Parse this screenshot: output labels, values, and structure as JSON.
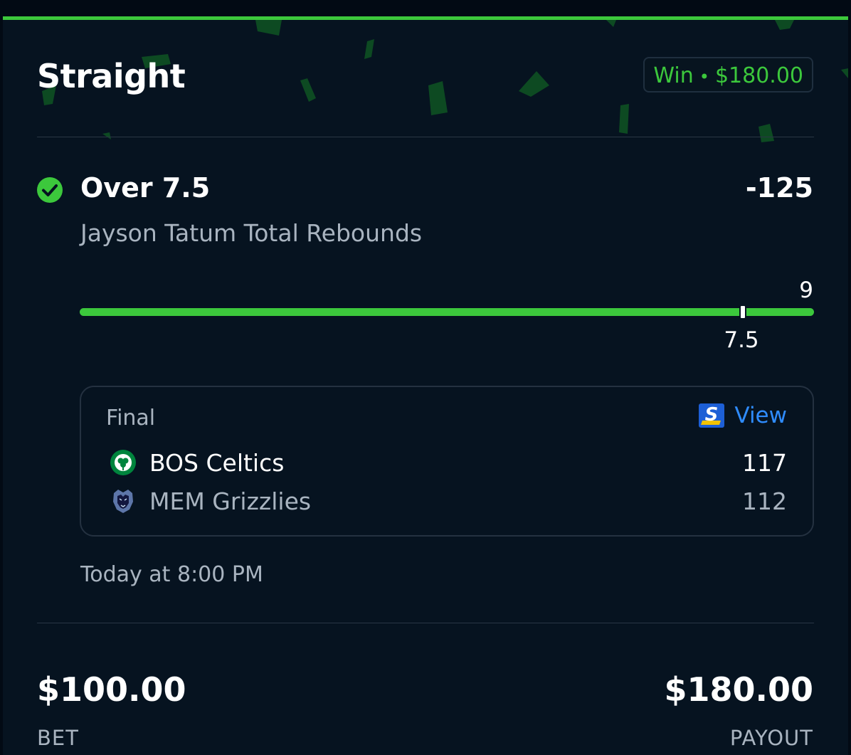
{
  "bet": {
    "type_label": "Straight",
    "result_label": "Win",
    "result_separator": "•",
    "result_amount": "$180.00",
    "selection": "Over 7.5",
    "odds": "-125",
    "market": "Jayson Tatum Total Rebounds"
  },
  "progress": {
    "current_value": "9",
    "line_value": "7.5",
    "current": 9,
    "line": 7.5,
    "fill_fraction": 1.0,
    "line_fraction": 0.901
  },
  "game": {
    "status": "Final",
    "view_label": "View",
    "teams": [
      {
        "name": "BOS Celtics",
        "score": "117",
        "logo": "celtics-logo"
      },
      {
        "name": "MEM Grizzlies",
        "score": "112",
        "logo": "grizzlies-logo"
      }
    ],
    "time": "Today at 8:00 PM"
  },
  "summary": {
    "bet_amount": "$100.00",
    "bet_label": "BET",
    "payout_amount": "$180.00",
    "payout_label": "PAYOUT"
  },
  "colors": {
    "accent_green": "#3cc83c",
    "link_blue": "#2f8cff",
    "background": "#061320",
    "muted_text": "#a9b4c0"
  },
  "icons": {
    "check": "check-circle-icon",
    "scoreboard": "theScore-logo-icon"
  }
}
